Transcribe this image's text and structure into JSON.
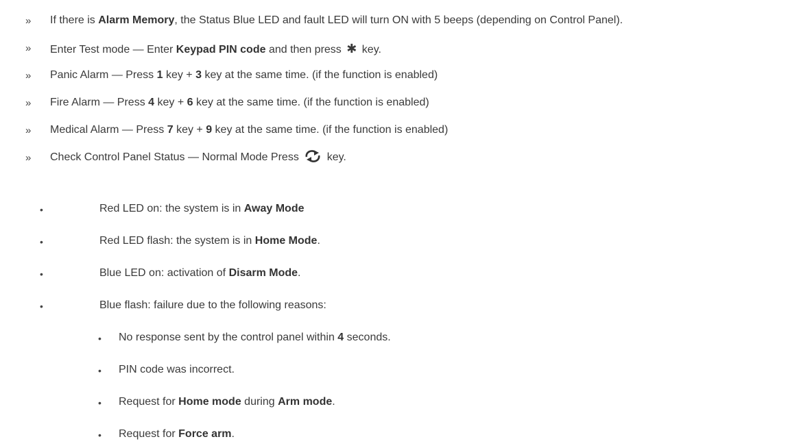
{
  "markers": {
    "chevron": "»",
    "bullet": "•"
  },
  "items": [
    {
      "p1": "If there is ",
      "b1": "Alarm Memory",
      "p2": ", the Status Blue LED and fault LED will turn ON with 5 beeps (depending on Control Panel)."
    },
    {
      "p1": "Enter Test mode — Enter ",
      "b1": "Keypad PIN code",
      "p2": " and then press",
      "p3": " key.",
      "icon": "asterisk-icon",
      "glyph": "✱"
    },
    {
      "p1": "Panic Alarm — Press ",
      "b1": "1",
      "p2": " key + ",
      "b2": "3",
      "p3": " key at the same time. (if the function is enabled)"
    },
    {
      "p1": "Fire Alarm — Press ",
      "b1": "4",
      "p2": " key + ",
      "b2": "6",
      "p3": " key at the same time. (if the function is enabled)"
    },
    {
      "p1": "Medical Alarm — Press ",
      "b1": "7",
      "p2": " key + ",
      "b2": "9",
      "p3": " key at the same time. (if the function is enabled)"
    },
    {
      "p1": "Check Control Panel Status — Normal Mode Press",
      "p2": " key.",
      "icon": "refresh-cycle-icon"
    }
  ],
  "status": [
    {
      "p1": "Red LED on: the system is in ",
      "b1": "Away Mode",
      "p2": ""
    },
    {
      "p1": "Red LED flash: the system is in ",
      "b1": "Home Mode",
      "p2": "."
    },
    {
      "p1": "Blue LED on: activation of ",
      "b1": "Disarm Mode",
      "p2": "."
    },
    {
      "p1": "Blue flash: failure due to the following reasons:"
    }
  ],
  "reasons": [
    {
      "p1": "No response sent by the control panel within ",
      "b1": "4",
      "p2": " seconds."
    },
    {
      "p1": "PIN code was incorrect."
    },
    {
      "p1": "Request for ",
      "b1": "Home mode",
      "p2": " during ",
      "b2": "Arm mode",
      "p3": "."
    },
    {
      "p1": "Request for ",
      "b1": "Force arm",
      "p2": "."
    }
  ]
}
